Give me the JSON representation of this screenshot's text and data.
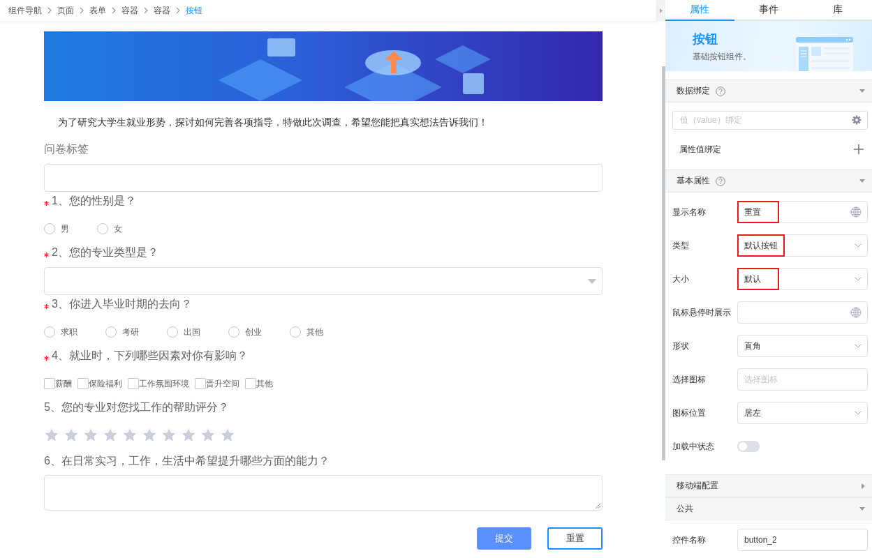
{
  "breadcrumb": [
    {
      "label": "组件导航",
      "current": false
    },
    {
      "label": "页面",
      "current": false
    },
    {
      "label": "表单",
      "current": false
    },
    {
      "label": "容器",
      "current": false
    },
    {
      "label": "容器",
      "current": false
    },
    {
      "label": "按钮",
      "current": true
    }
  ],
  "form": {
    "intro": "为了研究大学生就业形势，探讨如何完善各项指导，特做此次调查，希望您能把真实想法告诉我们！",
    "tag_label": "问卷标签",
    "questions": [
      {
        "kind": "radio",
        "required": true,
        "title": "1、您的性别是？",
        "options": [
          {
            "label": "男",
            "selected": false
          },
          {
            "label": "女",
            "selected": false
          }
        ]
      },
      {
        "kind": "select",
        "required": true,
        "title": "2、您的专业类型是？"
      },
      {
        "kind": "radio",
        "required": true,
        "title": "3、你进入毕业时期的去向？",
        "options": [
          {
            "label": "求职",
            "selected": false
          },
          {
            "label": "考研",
            "selected": false
          },
          {
            "label": "出国",
            "selected": false
          },
          {
            "label": "创业",
            "selected": false
          },
          {
            "label": "其他",
            "selected": false
          }
        ]
      },
      {
        "kind": "checkbox",
        "required": true,
        "title": "4、就业时，下列哪些因素对你有影响？",
        "options": [
          {
            "label": "薪酬",
            "checked": false
          },
          {
            "label": "保险福利",
            "checked": false
          },
          {
            "label": "工作氛围环境",
            "checked": false
          },
          {
            "label": "晋升空间",
            "checked": false
          },
          {
            "label": "其他",
            "checked": false
          }
        ]
      },
      {
        "kind": "rating",
        "required": false,
        "title": "5、您的专业对您找工作的帮助评分？",
        "stars": 0
      },
      {
        "kind": "textarea",
        "required": false,
        "title": "6、在日常实习，工作，生活中希望提升哪些方面的能力？"
      }
    ],
    "buttons": [
      {
        "label": "提交",
        "kind": "primary",
        "selected": false
      },
      {
        "label": "重置",
        "kind": "default",
        "selected": true
      }
    ]
  },
  "panel": {
    "tabs": [
      {
        "label": "属性",
        "selected": true
      },
      {
        "label": "事件",
        "selected": false
      },
      {
        "label": "库",
        "selected": false
      }
    ],
    "component": {
      "name": "按钮",
      "description": "基础按钮组件。"
    },
    "sections": [
      {
        "kind": "binding",
        "title": "数据绑定",
        "help": true,
        "expanded": true,
        "binding_placeholder": "值（value）绑定",
        "binding_label": "属性值绑定"
      },
      {
        "kind": "props",
        "title": "基本属性",
        "help": true,
        "expanded": true,
        "props": [
          {
            "label": "显示名称",
            "kind": "text",
            "value": "重置",
            "highlighted": true,
            "i18n": true
          },
          {
            "label": "类型",
            "kind": "select",
            "value": "默认按钮",
            "highlighted": true
          },
          {
            "label": "大小",
            "kind": "select",
            "value": "默认",
            "highlighted": true
          },
          {
            "label": "鼠标悬停时展示",
            "kind": "text",
            "highlighted": false,
            "i18n": true
          },
          {
            "label": "形状",
            "kind": "select",
            "value": "直角",
            "highlighted": false
          },
          {
            "label": "选择图标",
            "kind": "text",
            "placeholder": "选择图标",
            "highlighted": false,
            "i18n": false
          },
          {
            "label": "图标位置",
            "kind": "select",
            "value": "居左",
            "highlighted": false
          },
          {
            "label": "加载中状态",
            "kind": "switch",
            "on": false
          }
        ]
      },
      {
        "kind": "props",
        "title": "移动端配置",
        "help": false,
        "expanded": false
      },
      {
        "kind": "props",
        "title": "公共",
        "help": false,
        "expanded": true,
        "props": [
          {
            "label": "控件名称",
            "kind": "text",
            "value": "button_2",
            "highlighted": false,
            "i18n": false
          }
        ]
      }
    ]
  }
}
